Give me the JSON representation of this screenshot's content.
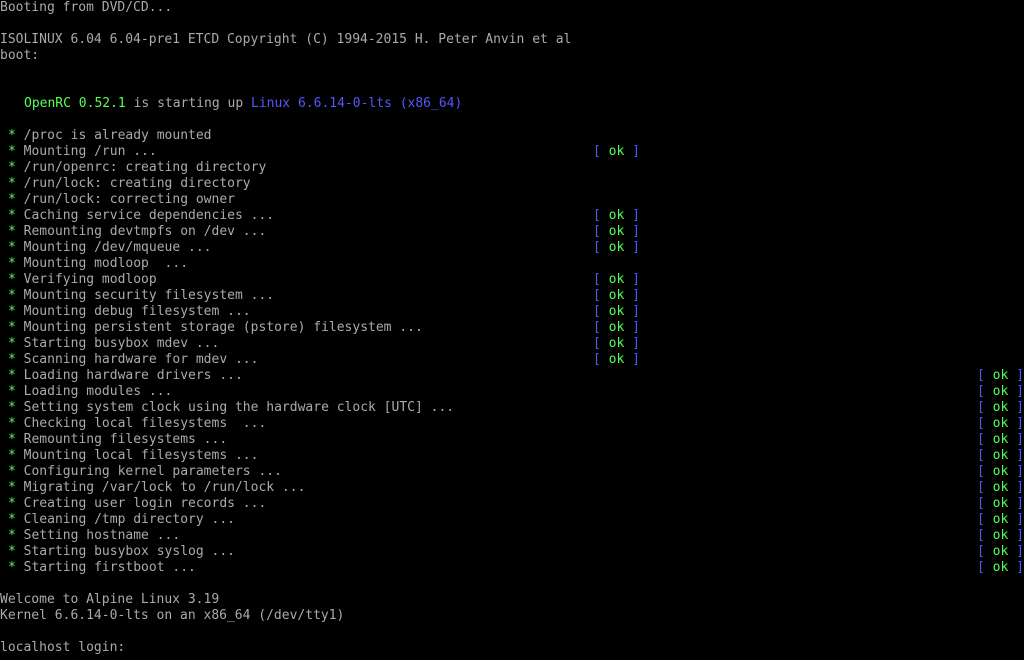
{
  "console": {
    "boot_media": "Booting from DVD/CD...",
    "isolinux": "ISOLINUX 6.04 6.04-pre1 ETCD Copyright (C) 1994-2015 H. Peter Anvin et al",
    "boot_prompt": "boot:",
    "openrc": {
      "name": "OpenRC",
      "version": "0.52.1",
      "middle": "is starting up",
      "kernel": "Linux 6.6.14-0-lts (x86_64)"
    },
    "star": "*",
    "bracket_open": "[",
    "bracket_close": "]",
    "status_ok": "ok",
    "services": [
      {
        "text": "/proc is already mounted",
        "ok": false,
        "col": 0
      },
      {
        "text": "Mounting /run ...",
        "ok": true,
        "col": 1
      },
      {
        "text": "/run/openrc: creating directory",
        "ok": false,
        "col": 0
      },
      {
        "text": "/run/lock: creating directory",
        "ok": false,
        "col": 0
      },
      {
        "text": "/run/lock: correcting owner",
        "ok": false,
        "col": 0
      },
      {
        "text": "Caching service dependencies ...",
        "ok": true,
        "col": 1
      },
      {
        "text": "Remounting devtmpfs on /dev ...",
        "ok": true,
        "col": 1
      },
      {
        "text": "Mounting /dev/mqueue ...",
        "ok": true,
        "col": 1
      },
      {
        "text": "Mounting modloop  ...",
        "ok": false,
        "col": 0
      },
      {
        "text": "Verifying modloop",
        "ok": true,
        "col": 1
      },
      {
        "text": "Mounting security filesystem ...",
        "ok": true,
        "col": 1
      },
      {
        "text": "Mounting debug filesystem ...",
        "ok": true,
        "col": 1
      },
      {
        "text": "Mounting persistent storage (pstore) filesystem ...",
        "ok": true,
        "col": 1
      },
      {
        "text": "Starting busybox mdev ...",
        "ok": true,
        "col": 1
      },
      {
        "text": "Scanning hardware for mdev ...",
        "ok": true,
        "col": 1
      },
      {
        "text": "Loading hardware drivers ...",
        "ok": true,
        "col": 2
      },
      {
        "text": "Loading modules ...",
        "ok": true,
        "col": 2
      },
      {
        "text": "Setting system clock using the hardware clock [UTC] ...",
        "ok": true,
        "col": 2
      },
      {
        "text": "Checking local filesystems  ...",
        "ok": true,
        "col": 2
      },
      {
        "text": "Remounting filesystems ...",
        "ok": true,
        "col": 2
      },
      {
        "text": "Mounting local filesystems ...",
        "ok": true,
        "col": 2
      },
      {
        "text": "Configuring kernel parameters ...",
        "ok": true,
        "col": 2
      },
      {
        "text": "Migrating /var/lock to /run/lock ...",
        "ok": true,
        "col": 2
      },
      {
        "text": "Creating user login records ...",
        "ok": true,
        "col": 2
      },
      {
        "text": "Cleaning /tmp directory ...",
        "ok": true,
        "col": 2
      },
      {
        "text": "Setting hostname ...",
        "ok": true,
        "col": 2
      },
      {
        "text": "Starting busybox syslog ...",
        "ok": true,
        "col": 2
      },
      {
        "text": "Starting firstboot ...",
        "ok": true,
        "col": 2
      }
    ],
    "welcome": "Welcome to Alpine Linux 3.19",
    "kernel_info": "Kernel 6.6.14-0-lts on an x86_64 (/dev/tty1)",
    "login_prompt": "localhost login:",
    "login_value": "",
    "colors": {
      "background": "#000000",
      "text": "#aaaaaa",
      "green": "#55ff55",
      "blue": "#5555ff"
    }
  }
}
